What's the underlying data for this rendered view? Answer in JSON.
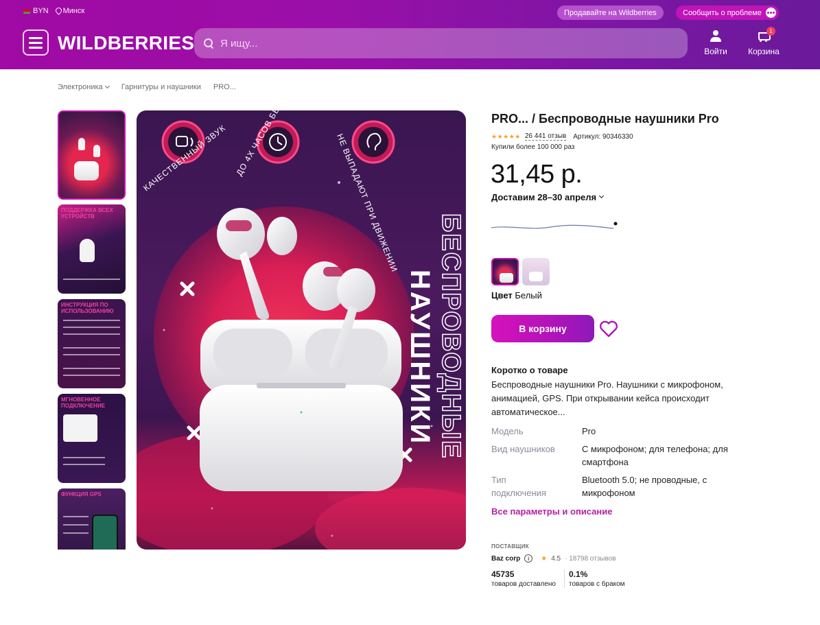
{
  "topbar": {
    "currency": "BYN",
    "city": "Минск",
    "sell_label": "Продавайте на Wildberries",
    "report_label": "Сообщить о проблеме"
  },
  "header": {
    "logo": "WILDBERRIES",
    "search_placeholder": "Я ищу...",
    "login_label": "Войти",
    "cart_label": "Корзина",
    "cart_count": "1"
  },
  "breadcrumb": [
    "Электроника",
    "Гарнитуры и наушники",
    "PRO..."
  ],
  "thumbnails": [
    {
      "caption": ""
    },
    {
      "caption": "ПОДДЕРЖКА ВСЕХ УСТРОЙСТВ"
    },
    {
      "caption": "ИНСТРУКЦИЯ ПО ИСПОЛЬЗОВАНИЮ"
    },
    {
      "caption": "МГНОВЕННОЕ ПОДКЛЮЧЕНИЕ"
    },
    {
      "caption": "ФУНКЦИЯ GPS"
    }
  ],
  "main_image": {
    "feature_1": "КАЧЕСТВЕННЫЙ ЗВУК",
    "feature_2": "ДО 4Х ЧАСОВ БЕЗ ПОДЗАРЯДА",
    "feature_3": "НЕ ВЫПАДАЮТ ПРИ ДВИЖЕНИИ",
    "vertical_1": "БЕСПРОВОДНЫЕ",
    "vertical_2": "НАУШНИКИ"
  },
  "product": {
    "title": "PRO... / Беспроводные наушники Pro",
    "stars": "★★★★★",
    "reviews": "26 441 отзыв",
    "sku": "Артикул: 90346330",
    "bought": "Купили более 100 000 раз",
    "price": "31,45 р.",
    "delivery": "Доставим 28–30 апреля",
    "color_label": "Цвет",
    "color_value": "Белый",
    "cart_button": "В корзину",
    "short_title": "Коротко о товаре",
    "short_desc": "Беспроводные наушники Pro. Наушники с микрофоном, анимацией, GPS. При открывании кейса происходит автоматическое...",
    "params": [
      {
        "key": "Модель",
        "value": "Pro"
      },
      {
        "key": "Вид наушников",
        "value": "С микрофоном; для телефона; для смартфона"
      },
      {
        "key": "Тип подключения",
        "value": "Bluetooth 5.0; не проводные, с микрофоном"
      }
    ],
    "all_params": "Все параметры и описание"
  },
  "supplier": {
    "label": "ПОСТАВЩИК",
    "name": "Baz corp",
    "rating": "4.5",
    "reviews": "18798 отзывов",
    "delivered_num": "45735",
    "delivered_label": "товаров доставлено",
    "defect_num": "0.1%",
    "defect_label": "товаров с браком"
  },
  "colors": {
    "accent": "#cb11ab",
    "header_start": "#a10aa4",
    "header_end": "#6a1a9a",
    "star": "#f3a02b"
  }
}
